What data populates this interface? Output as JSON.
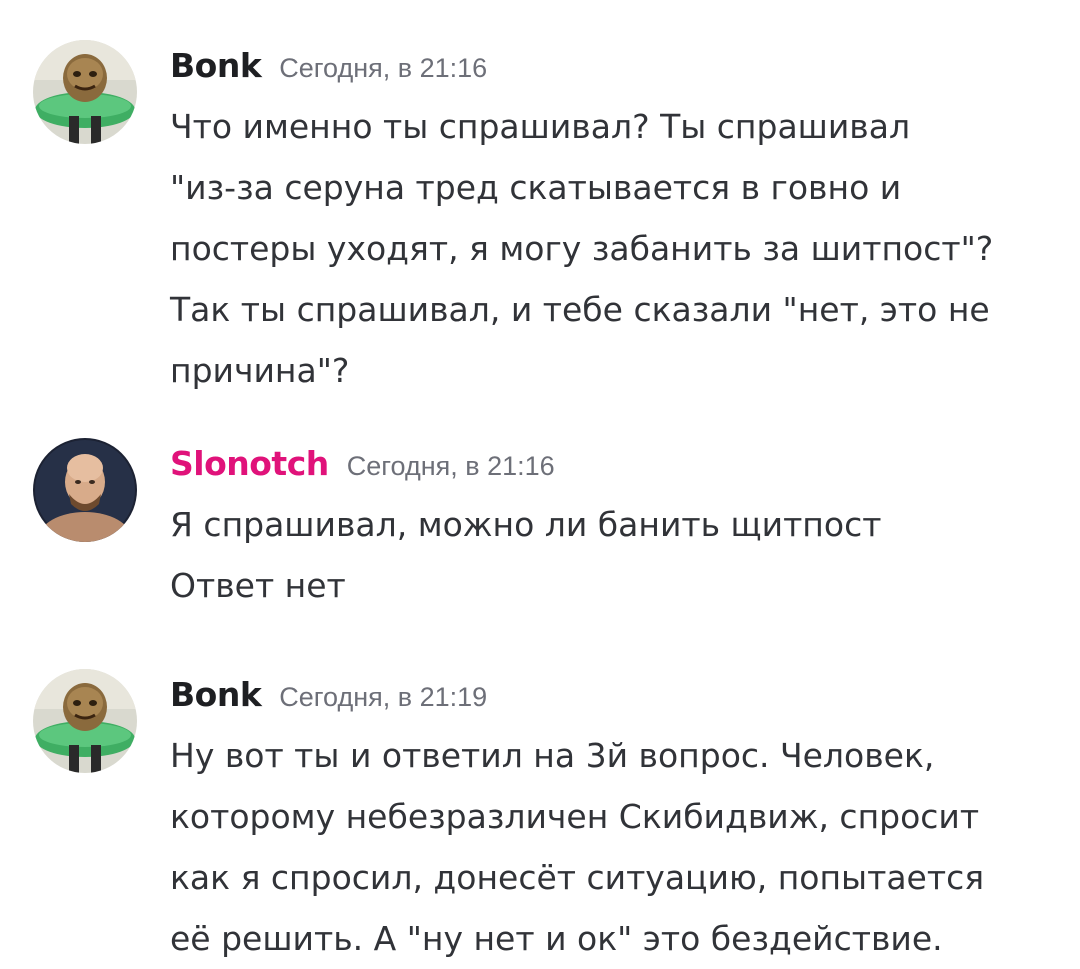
{
  "messages": [
    {
      "author": "Bonk",
      "timestamp": "Сегодня, в 21:16",
      "avatar_icon": "green-troll-avatar-icon",
      "lines": [
        "Что именно ты спрашивал? Ты спрашивал",
        "\"из-за серуна тред скатывается в говно и",
        "постеры уходят, я могу забанить за шитпост\"?",
        "Так ты спрашивал, и тебе сказали \"нет, это не",
        "причина\"?"
      ]
    },
    {
      "author": "Slonotch",
      "timestamp": "Сегодня, в 21:16",
      "author_color": "#e0127a",
      "avatar_icon": "bald-man-avatar-icon",
      "lines": [
        "Я спрашивал, можно ли банить щитпост",
        "Ответ нет"
      ]
    },
    {
      "author": "Bonk",
      "timestamp": "Сегодня, в 21:19",
      "avatar_icon": "green-troll-avatar-icon",
      "lines": [
        "Ну вот ты и ответил на 3й вопрос. Человек,",
        "которому небезразличен Скибидвиж, спросит",
        "как я спросил, донесёт ситуацию, попытается",
        "её решить. А \"ну нет и ок\" это бездействие."
      ]
    }
  ]
}
